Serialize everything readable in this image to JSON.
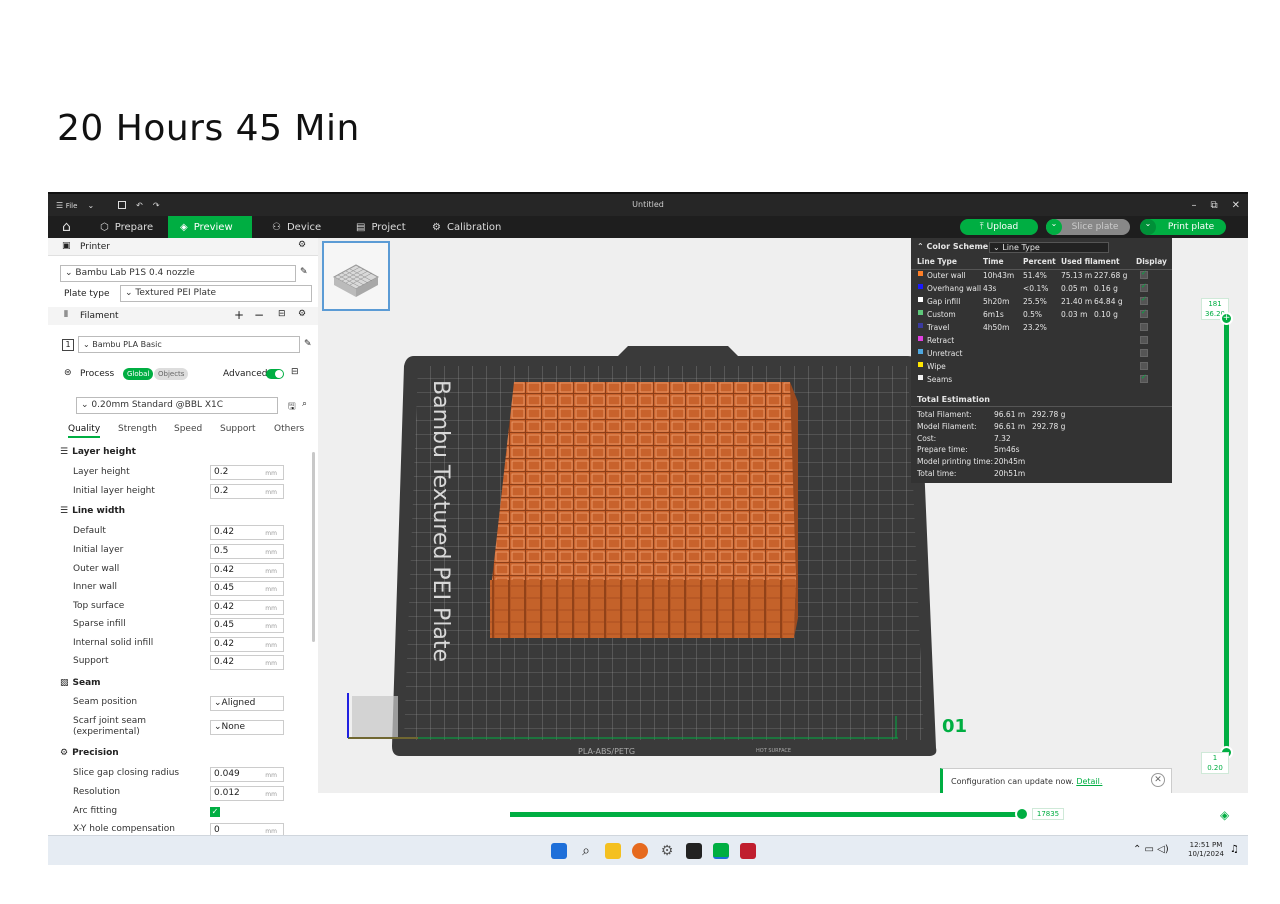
{
  "caption": "20 Hours 45 Min",
  "titlebar": {
    "file_label": "File",
    "title": "Untitled"
  },
  "nav": {
    "tabs": [
      {
        "label": "Prepare"
      },
      {
        "label": "Preview"
      },
      {
        "label": "Device"
      },
      {
        "label": "Project"
      },
      {
        "label": "Calibration"
      }
    ],
    "upload_label": "Upload",
    "slice_label": "Slice plate",
    "print_label": "Print plate"
  },
  "sidebar": {
    "printer_header": "Printer",
    "printer_value": "Bambu Lab P1S 0.4 nozzle",
    "plate_type_label": "Plate type",
    "plate_type_value": "Textured PEI Plate",
    "filament_header": "Filament",
    "filament_index": "1",
    "filament_value": "Bambu PLA Basic",
    "process_header": "Process",
    "process_global": "Global",
    "process_objects": "Objects",
    "advanced_label": "Advanced",
    "process_value": "0.20mm Standard @BBL X1C",
    "tabs": [
      "Quality",
      "Strength",
      "Speed",
      "Support",
      "Others"
    ],
    "sections": {
      "layer_height": "Layer height",
      "line_width": "Line width",
      "seam": "Seam",
      "precision": "Precision"
    },
    "unit": "mm",
    "layer_height_rows": [
      {
        "label": "Layer height",
        "value": "0.2"
      },
      {
        "label": "Initial layer height",
        "value": "0.2"
      }
    ],
    "line_width_rows": [
      {
        "label": "Default",
        "value": "0.42"
      },
      {
        "label": "Initial layer",
        "value": "0.5"
      },
      {
        "label": "Outer wall",
        "value": "0.42"
      },
      {
        "label": "Inner wall",
        "value": "0.45"
      },
      {
        "label": "Top surface",
        "value": "0.42"
      },
      {
        "label": "Sparse infill",
        "value": "0.45"
      },
      {
        "label": "Internal solid infill",
        "value": "0.42"
      },
      {
        "label": "Support",
        "value": "0.42"
      }
    ],
    "seam_rows": [
      {
        "label": "Seam position",
        "value": "Aligned"
      },
      {
        "label": "Scarf joint seam (experimental)",
        "value": "None"
      }
    ],
    "precision_rows": [
      {
        "label": "Slice gap closing radius",
        "value": "0.049"
      },
      {
        "label": "Resolution",
        "value": "0.012"
      },
      {
        "label": "Arc fitting",
        "value": ""
      },
      {
        "label": "X-Y hole compensation",
        "value": "0"
      }
    ]
  },
  "plate": {
    "brand_text": "Bambu Textured PEI Plate",
    "plate_number": "01",
    "bottom_label": "PLA-ABS/PETG",
    "hot_label": "HOT SURFACE"
  },
  "legend": {
    "title": "Color Scheme",
    "scheme_value": "Line Type",
    "headers": [
      "Line Type",
      "Time",
      "Percent",
      "Used filament",
      "Display"
    ],
    "rows": [
      {
        "name": "Outer wall",
        "color": "#ff7f27",
        "time": "10h43m",
        "percent": "51.4%",
        "len": "75.13 m",
        "weight": "227.68 g",
        "display": true
      },
      {
        "name": "Overhang wall",
        "color": "#1a1aff",
        "time": "43s",
        "percent": "<0.1%",
        "len": "0.05 m",
        "weight": "0.16 g",
        "display": true
      },
      {
        "name": "Gap infill",
        "color": "#ffffff",
        "time": "5h20m",
        "percent": "25.5%",
        "len": "21.40 m",
        "weight": "64.84 g",
        "display": true
      },
      {
        "name": "Custom",
        "color": "#5ec87a",
        "time": "6m1s",
        "percent": "0.5%",
        "len": "0.03 m",
        "weight": "0.10 g",
        "display": true
      },
      {
        "name": "Travel",
        "color": "#3a3aa0",
        "time": "4h50m",
        "percent": "23.2%",
        "len": "",
        "weight": "",
        "display": false
      },
      {
        "name": "Retract",
        "color": "#e040e0",
        "time": "",
        "percent": "",
        "len": "",
        "weight": "",
        "display": false
      },
      {
        "name": "Unretract",
        "color": "#4fa8e0",
        "time": "",
        "percent": "",
        "len": "",
        "weight": "",
        "display": false
      },
      {
        "name": "Wipe",
        "color": "#ffe600",
        "time": "",
        "percent": "",
        "len": "",
        "weight": "",
        "display": false
      },
      {
        "name": "Seams",
        "color": "#f2f2f2",
        "time": "",
        "percent": "",
        "len": "",
        "weight": "",
        "display": true
      }
    ],
    "total_title": "Total Estimation",
    "totals": [
      {
        "label": "Total Filament:",
        "v1": "96.61 m",
        "v2": "292.78 g"
      },
      {
        "label": "Model Filament:",
        "v1": "96.61 m",
        "v2": "292.78 g"
      },
      {
        "label": "Cost:",
        "v1": "7.32",
        "v2": ""
      },
      {
        "label": "Prepare time:",
        "v1": "5m46s",
        "v2": ""
      },
      {
        "label": "Model printing time:",
        "v1": "20h45m",
        "v2": ""
      },
      {
        "label": "Total time:",
        "v1": "20h51m",
        "v2": ""
      }
    ]
  },
  "vslider": {
    "top_layer": "181",
    "top_height": "36.20",
    "bottom_layer": "1",
    "bottom_height": "0.20"
  },
  "hslider": {
    "value": "17835"
  },
  "notification": {
    "text": "Configuration can update now.",
    "link": "Detail."
  },
  "taskbar": {
    "time": "12:51 PM",
    "date": "10/1/2024"
  }
}
